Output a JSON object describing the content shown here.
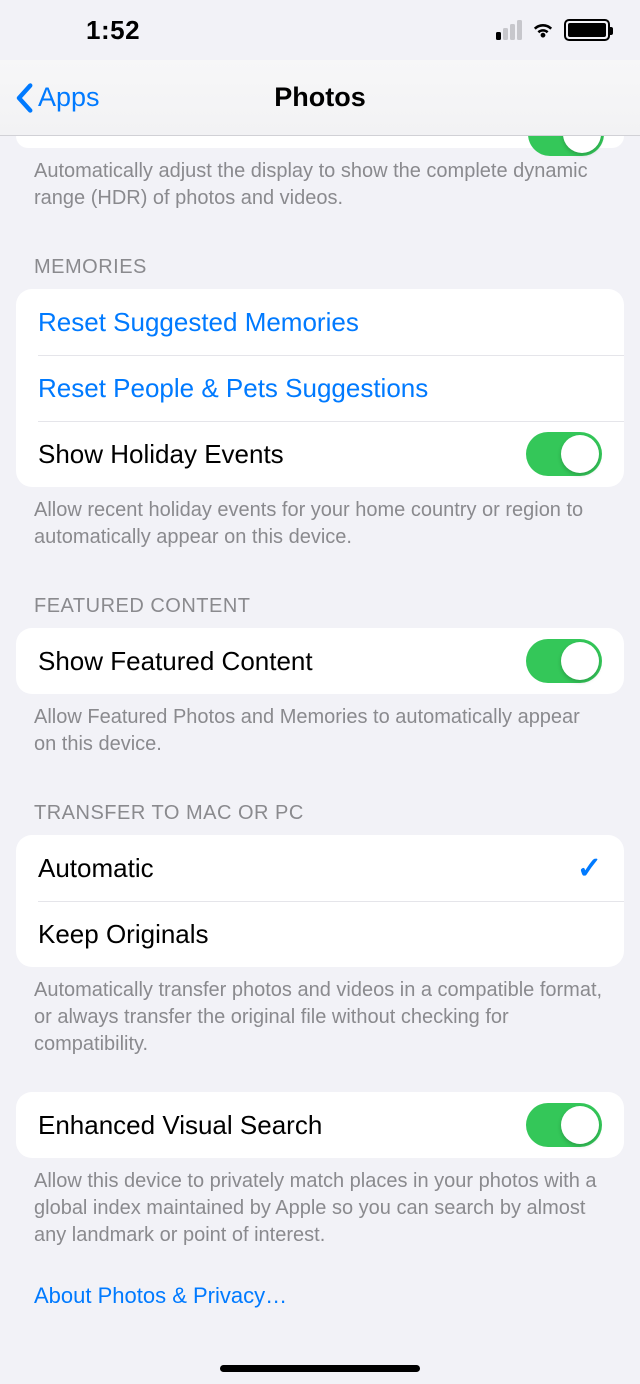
{
  "status": {
    "time": "1:52"
  },
  "nav": {
    "back": "Apps",
    "title": "Photos"
  },
  "hdr": {
    "footer": "Automatically adjust the display to show the complete dynamic range (HDR) of photos and videos."
  },
  "memories": {
    "header": "MEMORIES",
    "reset_memories": "Reset Suggested Memories",
    "reset_people": "Reset People & Pets Suggestions",
    "holiday_label": "Show Holiday Events",
    "footer": "Allow recent holiday events for your home country or region to automatically appear on this device."
  },
  "featured": {
    "header": "FEATURED CONTENT",
    "label": "Show Featured Content",
    "footer": "Allow Featured Photos and Memories to automatically appear on this device."
  },
  "transfer": {
    "header": "TRANSFER TO MAC OR PC",
    "automatic": "Automatic",
    "keep_originals": "Keep Originals",
    "footer": "Automatically transfer photos and videos in a compatible format, or always transfer the original file without checking for compatibility."
  },
  "evs": {
    "label": "Enhanced Visual Search",
    "footer": "Allow this device to privately match places in your photos with a global index maintained by Apple so you can search by almost any landmark or point of interest."
  },
  "privacy": {
    "link": "About Photos & Privacy…"
  }
}
